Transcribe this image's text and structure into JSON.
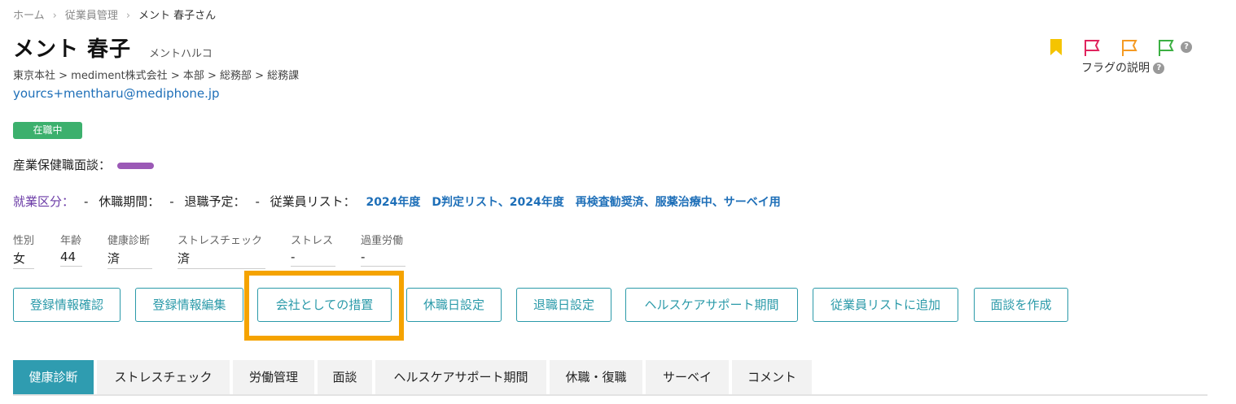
{
  "breadcrumb": {
    "home": "ホーム",
    "section": "従業員管理",
    "current": "メント 春子さん"
  },
  "employee": {
    "name": "メント 春子",
    "kana": "メントハルコ",
    "org_path": "東京本社 > mediment株式会社 > 本部 > 総務部 > 総務課",
    "email": "yourcs+mentharu@mediphone.jp",
    "status_badge": "在職中",
    "interview_label": "産業保健職面談：",
    "interview_color": "#9b59b6"
  },
  "work_info": {
    "category_label": "就業区分：",
    "category_value": "-",
    "leave_label": "休職期間：",
    "leave_value": "-",
    "retire_label": "退職予定：",
    "retire_value": "-",
    "list_label": "従業員リスト：",
    "list_value": "2024年度　D判定リスト、2024年度　再検査勧奨済、服薬治療中、サーベイ用"
  },
  "stats": [
    {
      "label": "性別",
      "value": "女"
    },
    {
      "label": "年齢",
      "value": "44"
    },
    {
      "label": "健康診断",
      "value": "済"
    },
    {
      "label": "ストレスチェック",
      "value": "済"
    },
    {
      "label": "ストレス",
      "value": "-"
    },
    {
      "label": "過重労働",
      "value": "-"
    }
  ],
  "actions": [
    "登録情報確認",
    "登録情報編集",
    "会社としての措置",
    "休職日設定",
    "退職日設定",
    "ヘルスケアサポート期間",
    "従業員リストに追加",
    "面談を作成"
  ],
  "tabs": [
    "健康診断",
    "ストレスチェック",
    "労働管理",
    "面談",
    "ヘルスケアサポート期間",
    "休職・復職",
    "サーベイ",
    "コメント"
  ],
  "flags": {
    "help_label": "フラグの説明",
    "colors": {
      "bookmark": "#f5c400",
      "red": "#e0245e",
      "orange": "#f59a23",
      "green": "#3cb043"
    }
  },
  "colors": {
    "accent": "#2b9aa9",
    "highlight": "#f5a300",
    "active_status": "#3cb06d"
  }
}
